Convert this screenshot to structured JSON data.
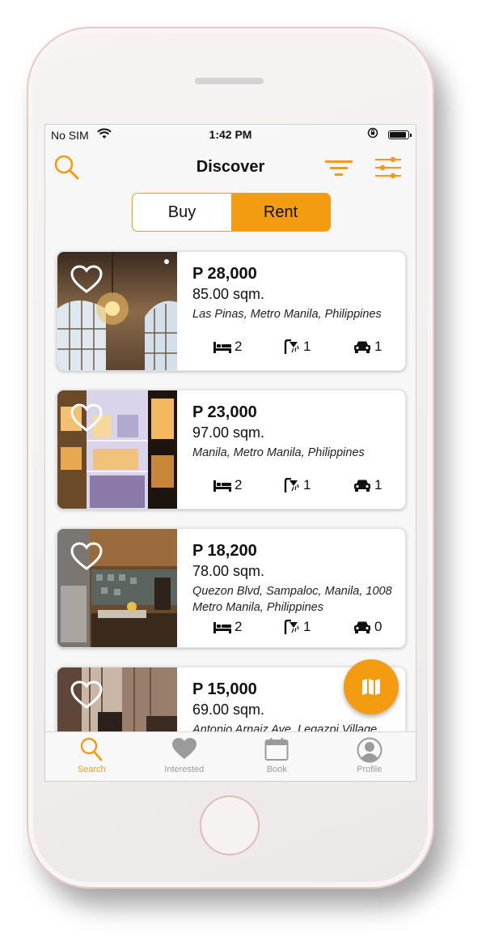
{
  "status_bar": {
    "carrier": "No SIM",
    "time": "1:42 PM"
  },
  "header": {
    "title": "Discover"
  },
  "segment": {
    "options": [
      "Buy",
      "Rent"
    ],
    "selected": "Rent"
  },
  "listings": [
    {
      "price": "P 28,000",
      "area": "85.00 sqm.",
      "location": "Las Pinas, Metro Manila, Philippines",
      "bedrooms": "2",
      "bathrooms": "1",
      "parking": "1"
    },
    {
      "price": "P 23,000",
      "area": "97.00 sqm.",
      "location": "Manila, Metro Manila, Philippines",
      "bedrooms": "2",
      "bathrooms": "1",
      "parking": "1"
    },
    {
      "price": "P 18,200",
      "area": "78.00 sqm.",
      "location": "Quezon Blvd, Sampaloc, Manila, 1008 Metro Manila, Philippines",
      "bedrooms": "2",
      "bathrooms": "1",
      "parking": "0"
    },
    {
      "price": "P 15,000",
      "area": "69.00 sqm.",
      "location": "Antonio Arnaiz Ave, Legazpi Village,"
    }
  ],
  "tabs": [
    {
      "label": "Search",
      "icon": "search-icon"
    },
    {
      "label": "Interested",
      "icon": "heart-icon"
    },
    {
      "label": "Book",
      "icon": "calendar-icon"
    },
    {
      "label": "Profile",
      "icon": "profile-icon"
    }
  ],
  "colors": {
    "accent": "#f39c12",
    "inactive": "#9b9b9b"
  }
}
